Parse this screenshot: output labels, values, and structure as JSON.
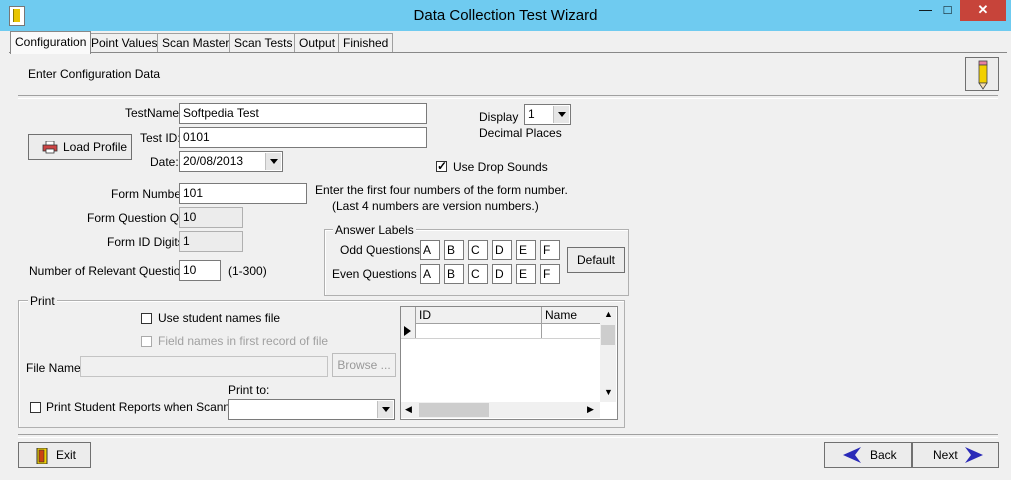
{
  "window": {
    "title": "Data Collection Test Wizard",
    "minimize": "—",
    "maximize": "□",
    "close": "✕"
  },
  "tabs": [
    "Configuration",
    "Point Values",
    "Scan Master",
    "Scan Tests",
    "Output",
    "Finished"
  ],
  "header": {
    "instruction": "Enter Configuration Data"
  },
  "form": {
    "test_name_label": "TestName:",
    "test_name_value": "Softpedia Test",
    "test_id_label": "Test ID:",
    "test_id_value": "0101",
    "date_label": "Date:",
    "date_value": "20/08/2013",
    "load_profile_label": "Load Profile",
    "display_label": "Display",
    "decimal_places_label": "Decimal Places",
    "display_value": "1",
    "use_drop_sounds_label": "Use Drop Sounds",
    "use_drop_sounds_checked": true,
    "form_number_label": "Form Number:",
    "form_number_value": "101",
    "form_number_hint_1": "Enter the first four numbers of the form number.",
    "form_number_hint_2": "(Last 4 numbers are version numbers.)",
    "form_question_qty_label": "Form Question Qty:",
    "form_question_qty_value": "10",
    "form_id_digits_label": "Form ID Digits:",
    "form_id_digits_value": "1",
    "relevant_questions_label": "Number of Relevant Questions:",
    "relevant_questions_value": "10",
    "relevant_questions_range": "(1-300)"
  },
  "answer_labels": {
    "title": "Answer Labels",
    "odd_label": "Odd Questions",
    "even_label": "Even Questions",
    "odd": [
      "A",
      "B",
      "C",
      "D",
      "E",
      "F"
    ],
    "even": [
      "A",
      "B",
      "C",
      "D",
      "E",
      "F"
    ],
    "default_button": "Default"
  },
  "print": {
    "title": "Print",
    "use_student_names_label": "Use student names file",
    "field_names_label": "Field names in first record of file",
    "file_name_label": "File Name:",
    "file_name_value": "",
    "browse_label": "Browse ...",
    "print_to_label": "Print to:",
    "print_to_value": "",
    "print_reports_label": "Print Student Reports when Scanned",
    "grid_columns": [
      "ID",
      "Name"
    ]
  },
  "footer": {
    "exit_label": "Exit",
    "back_label": "Back",
    "next_label": "Next"
  },
  "colors": {
    "titlebar": "#6fcbf0",
    "close_button": "#c7443a",
    "nav_arrow": "#2a2ab8"
  }
}
